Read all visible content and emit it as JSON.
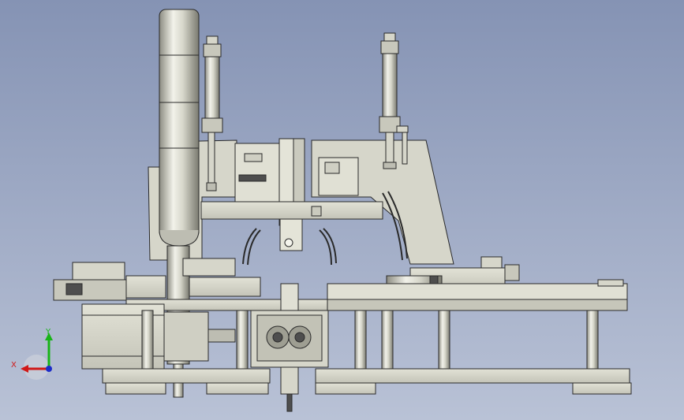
{
  "viewport": {
    "background_top": "#8593b4",
    "background_bottom": "#b9c2d6"
  },
  "triad": {
    "x_label": "X",
    "y_label": "Y",
    "x_color": "#d01818",
    "y_color": "#18b418",
    "z_color": "#1c2cc8"
  },
  "model": {
    "part_color": "#d8d8cc",
    "shadow_color": "#9e9e92",
    "edge_color": "#2a2a2a",
    "dark_color": "#4e4e4e"
  }
}
